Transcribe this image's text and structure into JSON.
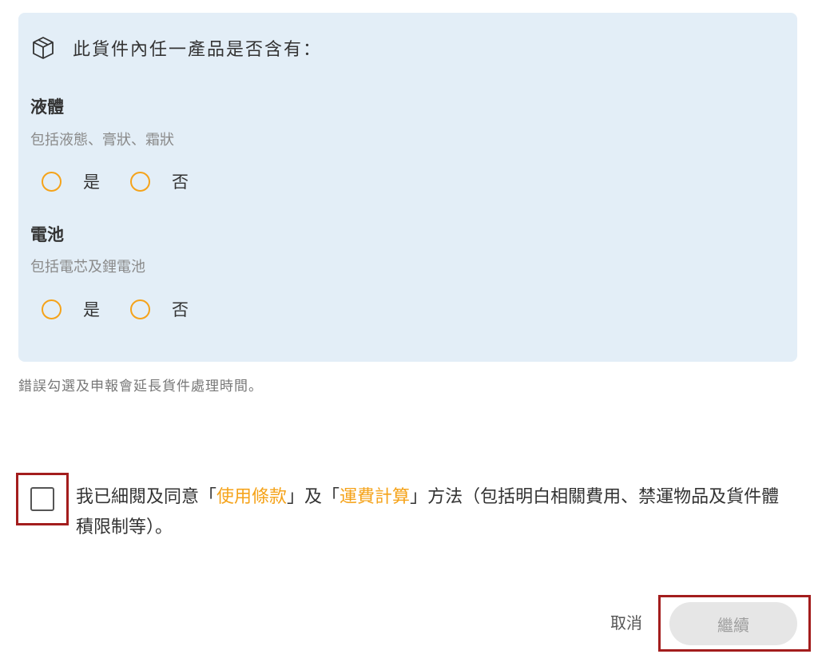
{
  "question": {
    "icon": "box-icon",
    "text": "此貨件內任一產品是否含有："
  },
  "sections": [
    {
      "title": "液體",
      "subtitle": "包括液態、膏狀、霜狀",
      "options": [
        {
          "label": "是",
          "selected": false
        },
        {
          "label": "否",
          "selected": false
        }
      ]
    },
    {
      "title": "電池",
      "subtitle": "包括電芯及鋰電池",
      "options": [
        {
          "label": "是",
          "selected": false
        },
        {
          "label": "否",
          "selected": false
        }
      ]
    }
  ],
  "note": "錯誤勾選及申報會延長貨件處理時間。",
  "agreement": {
    "checked": false,
    "text_before": "我已細閱及同意「",
    "link_terms": "使用條款",
    "text_middle": "」及「",
    "link_shipping": "運費計算",
    "text_after": "」方法（包括明白相關費用、禁運物品及貨件體積限制等）。"
  },
  "actions": {
    "cancel_label": "取消",
    "continue_label": "繼續",
    "continue_enabled": false
  },
  "colors": {
    "panel_bg": "#e3eef7",
    "accent": "#f5a31a",
    "highlight_frame": "#a31d1d",
    "disabled_button_bg": "#e6e6e6"
  }
}
